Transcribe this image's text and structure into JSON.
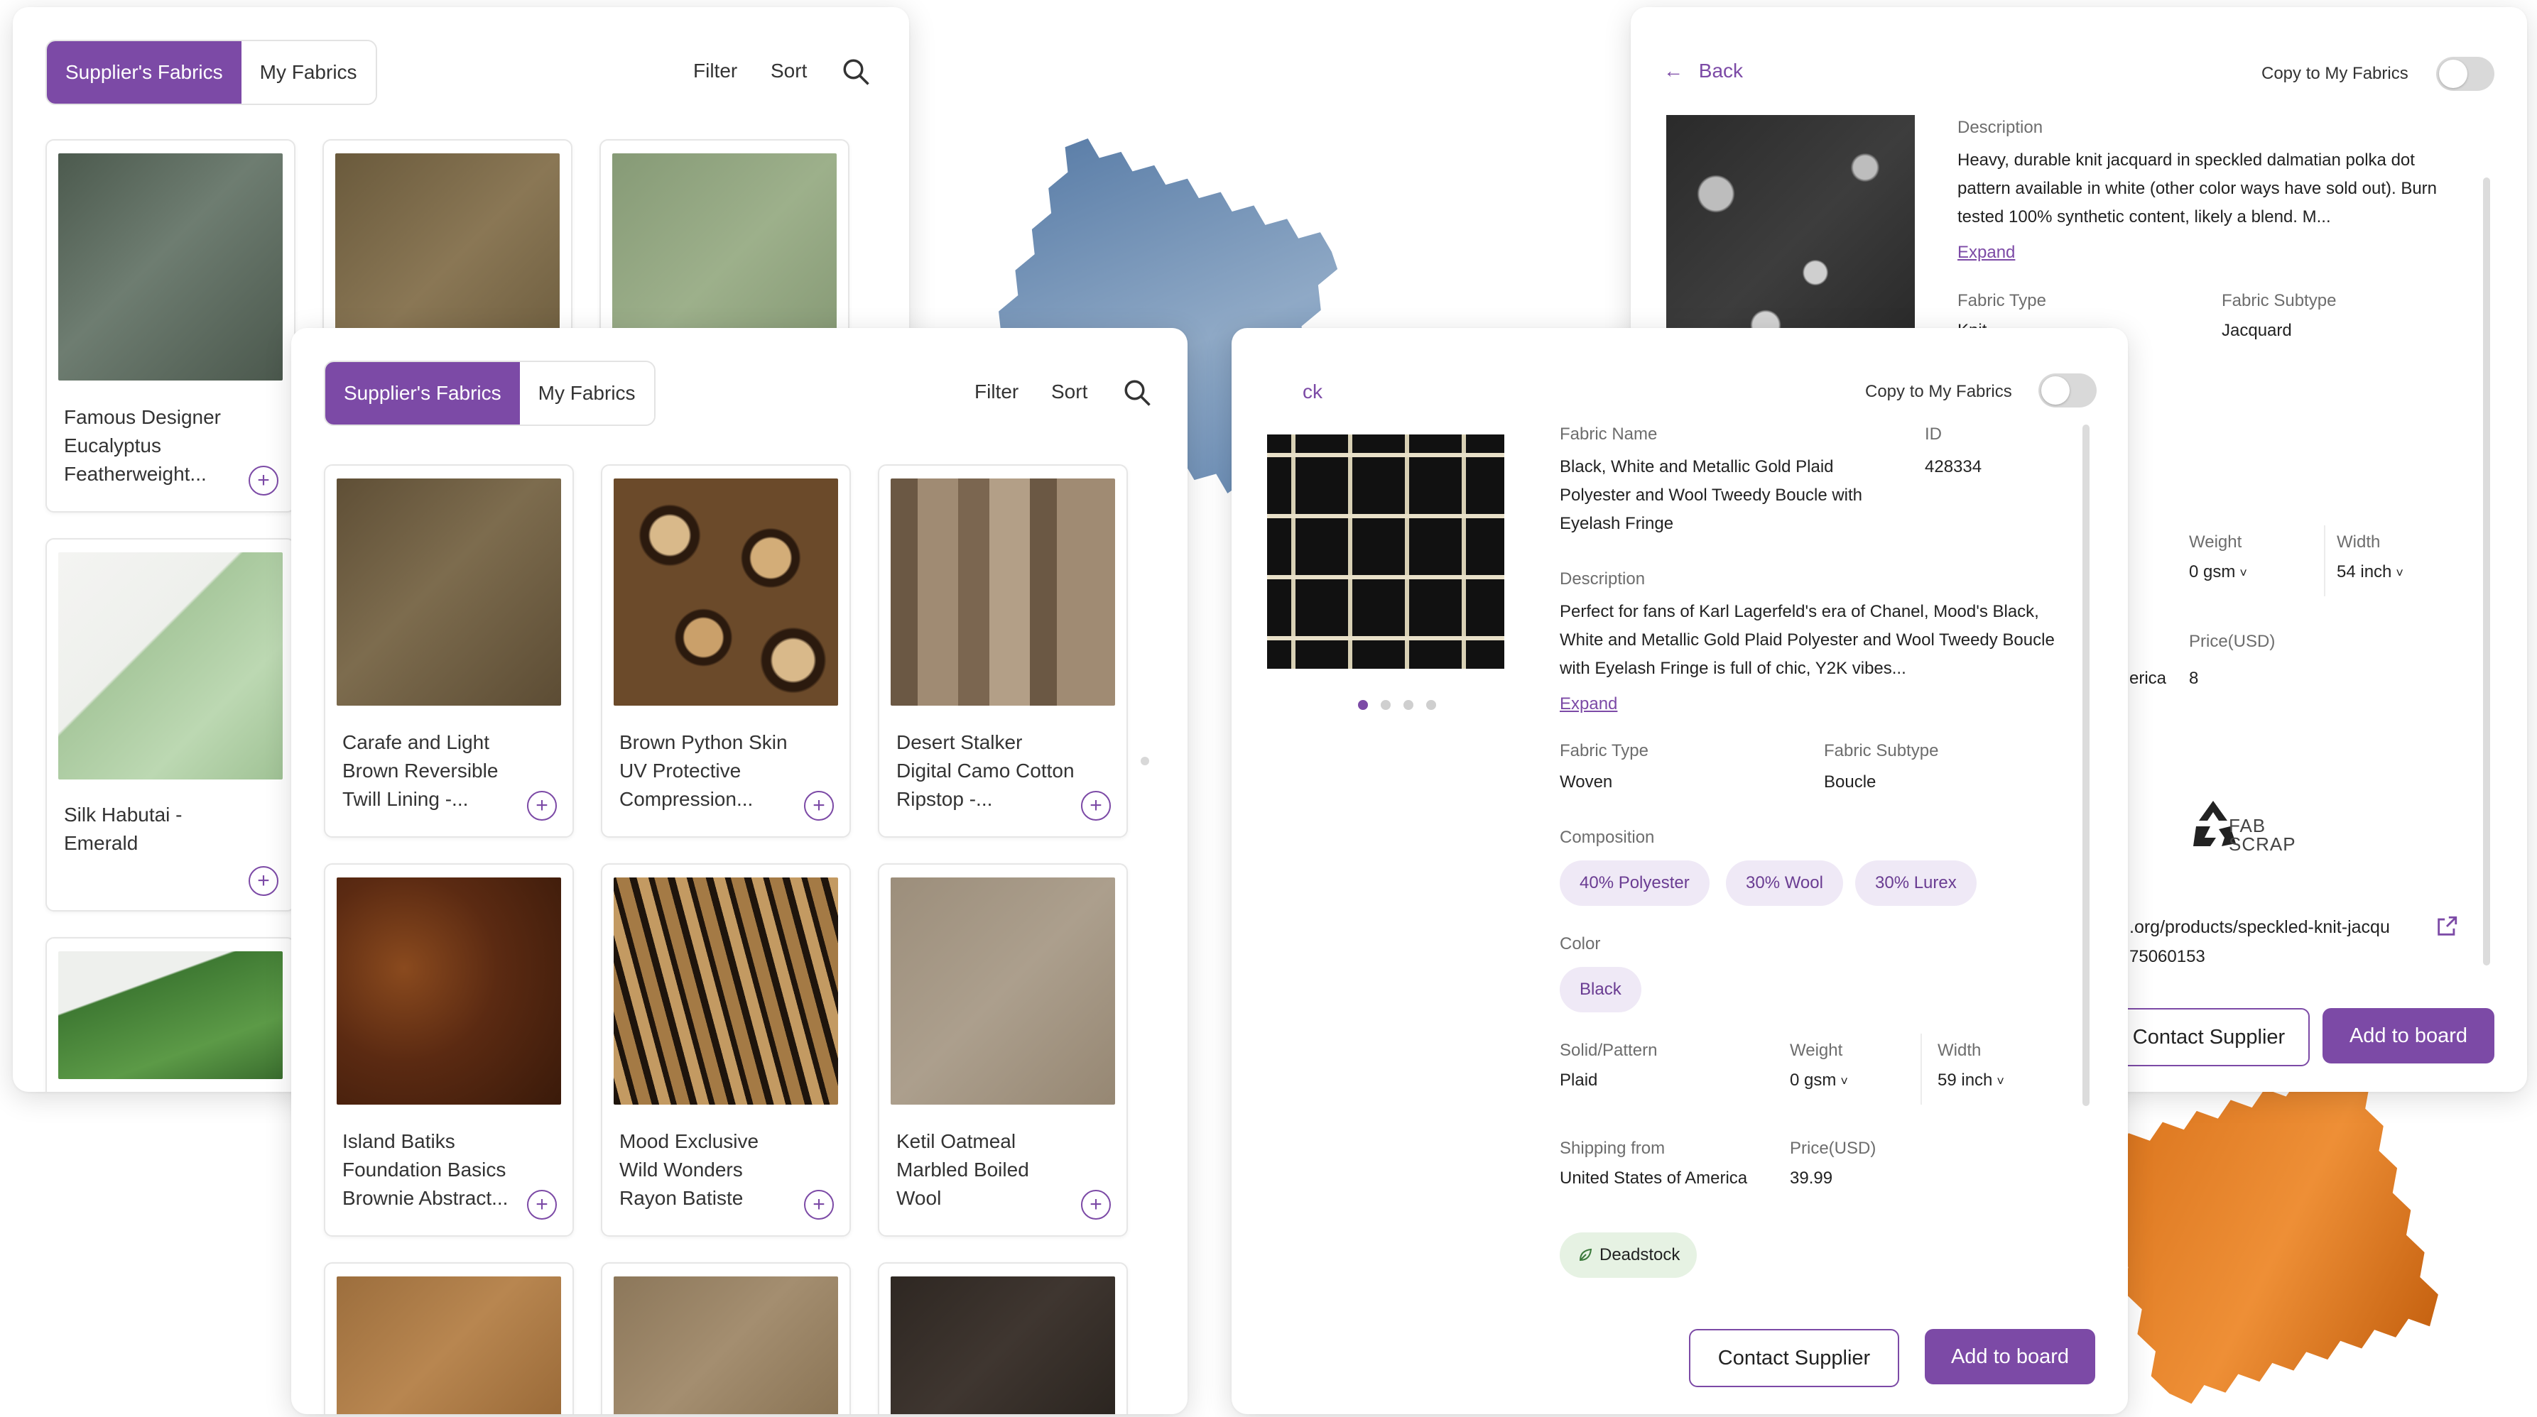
{
  "back_panel_left": {
    "tabs": [
      "Supplier's Fabrics",
      "My Fabrics"
    ],
    "filter": "Filter",
    "sort": "Sort",
    "cards": [
      {
        "title": "Famous Designer Eucalyptus Featherweight...",
        "color": "#58655a"
      },
      {
        "title": "",
        "color": "#7c6a4a"
      },
      {
        "title": "",
        "color": "#8ea07e"
      },
      {
        "title": "Silk Habutai - Emerald",
        "color": "#a9c8a0"
      },
      {
        "title": "",
        "color": "#4d7a3e"
      }
    ]
  },
  "front_panel_left": {
    "tabs": [
      "Supplier's Fabrics",
      "My Fabrics"
    ],
    "filter": "Filter",
    "sort": "Sort",
    "cards": [
      {
        "title": "Carafe and Light Brown Reversible Twill Lining -...",
        "color": "#6d5b3f"
      },
      {
        "title": "Brown Python Skin UV Protective Compression...",
        "color": "#6a4a2a"
      },
      {
        "title": "Desert Stalker Digital Camo Cotton Ripstop -...",
        "color": "#8f7a62"
      },
      {
        "title": "Island Batiks Foundation Basics Brownie Abstract...",
        "color": "#5b2a12"
      },
      {
        "title": "Mood Exclusive Wild Wonders Rayon Batiste",
        "color": "#7a5a35"
      },
      {
        "title": "Ketil Oatmeal Marbled Boiled Wool",
        "color": "#a39583"
      },
      {
        "title": "",
        "color": "#a57745"
      },
      {
        "title": "",
        "color": "#9a8466"
      },
      {
        "title": "",
        "color": "#3a322c"
      }
    ]
  },
  "back_panel_right": {
    "back_label": "Back",
    "copy_label": "Copy to My Fabrics",
    "description_label": "Description",
    "description": "Heavy, durable knit jacquard in speckled dalmatian polka dot pattern available in white (other color ways have sold out). Burn tested 100% synthetic content, likely a blend. M...",
    "expand": "Expand",
    "fabric_type_label": "Fabric Type",
    "fabric_type_value": "Knit",
    "fabric_subtype_label": "Fabric Subtype",
    "fabric_subtype_value": "Jacquard",
    "weight_label": "Weight",
    "weight_value": "0 gsm",
    "width_label": "Width",
    "width_value": "54 inch",
    "shipping_value": "erica",
    "price_label": "Price(USD)",
    "price_value": "8",
    "logo_text": "FAB SCRAP",
    "url": ".org/products/speckled-knit-jacqu",
    "id_fragment": "75060153",
    "contact_supplier": "Contact Supplier",
    "add_to_board": "Add to board"
  },
  "front_panel_right": {
    "back_fragment": "ck",
    "copy_label": "Copy to My Fabrics",
    "fabric_name_label": "Fabric Name",
    "fabric_name": "Black, White and Metallic Gold Plaid Polyester and Wool Tweedy Boucle with Eyelash Fringe",
    "id_label": "ID",
    "id_value": "428334",
    "description_label": "Description",
    "description": "Perfect for fans of Karl Lagerfeld's era of Chanel, Mood's Black, White and Metallic Gold Plaid Polyester and Wool Tweedy Boucle with Eyelash Fringe is full of chic, Y2K vibes...",
    "expand": "Expand",
    "fabric_type_label": "Fabric Type",
    "fabric_type_value": "Woven",
    "fabric_subtype_label": "Fabric Subtype",
    "fabric_subtype_value": "Boucle",
    "composition_label": "Composition",
    "composition": [
      "40% Polyester",
      "30% Wool",
      "30% Lurex"
    ],
    "color_label": "Color",
    "color_value": "Black",
    "solid_label": "Solid/Pattern",
    "solid_value": "Plaid",
    "weight_label": "Weight",
    "weight_value": "0 gsm",
    "width_label": "Width",
    "width_value": "59 inch",
    "shipping_label": "Shipping from",
    "shipping_value": "United States of America",
    "price_label": "Price(USD)",
    "price_value": "39.99",
    "deadstock": "Deadstock",
    "contact_supplier": "Contact Supplier",
    "add_to_board": "Add to board"
  }
}
